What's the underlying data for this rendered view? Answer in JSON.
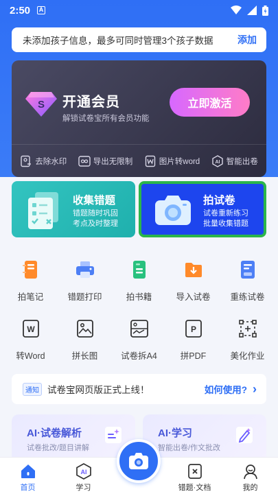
{
  "status": {
    "time": "2:50",
    "badge": "A"
  },
  "notice": {
    "text": "未添加孩子信息，最多可同时管理3个孩子数据",
    "action": "添加"
  },
  "vip": {
    "title": "开通会员",
    "subtitle": "解锁试卷宝所有会员功能",
    "button": "立即激活",
    "features": [
      {
        "label": "去除水印",
        "icon": "no-watermark-icon"
      },
      {
        "label": "导出无限制",
        "icon": "infinity-icon"
      },
      {
        "label": "图片转word",
        "icon": "word-doc-icon"
      },
      {
        "label": "智能出卷",
        "icon": "ai-icon"
      }
    ],
    "gem_letter": "S"
  },
  "cards": {
    "collect": {
      "title": "收集错题",
      "sub1": "错题随时巩固",
      "sub2": "考点及时整理"
    },
    "shoot": {
      "title": "拍试卷",
      "sub1": "试卷重新练习",
      "sub2": "批量收集错题"
    }
  },
  "tools_row1": [
    {
      "label": "拍笔记",
      "icon": "notebook-icon",
      "color": "#ff8a2a"
    },
    {
      "label": "错题打印",
      "icon": "printer-icon",
      "color": "#4d7ff5"
    },
    {
      "label": "拍书籍",
      "icon": "book-icon",
      "color": "#28c17e"
    },
    {
      "label": "导入试卷",
      "icon": "folder-import-icon",
      "color": "#ff8a2a"
    },
    {
      "label": "重练试卷",
      "icon": "paper-redo-icon",
      "color": "#4d7ff5"
    }
  ],
  "tools_row2": [
    {
      "label": "转Word",
      "icon": "word-icon",
      "glyph": "W"
    },
    {
      "label": "拼长图",
      "icon": "long-image-icon"
    },
    {
      "label": "试卷拆A4",
      "icon": "split-a4-icon"
    },
    {
      "label": "拼PDF",
      "icon": "pdf-icon",
      "glyph": "P"
    },
    {
      "label": "美化作业",
      "icon": "beautify-icon"
    }
  ],
  "announce": {
    "tag": "通知",
    "text": "试卷宝网页版正式上线！",
    "link": "如何使用?",
    "arrow": "›"
  },
  "ai_cards": [
    {
      "title": "AI·试卷解析",
      "sub": "试卷批改/题目讲解"
    },
    {
      "title": "AI·学习",
      "sub": "智能出卷/作文批改"
    }
  ],
  "tabs": [
    {
      "label": "首页",
      "icon": "home-icon"
    },
    {
      "label": "学习",
      "icon": "ai-study-icon",
      "glyph": "AI"
    },
    {
      "label": "",
      "icon": "camera-icon"
    },
    {
      "label": "错题·文档",
      "icon": "wrong-doc-icon"
    },
    {
      "label": "我的",
      "icon": "profile-icon"
    }
  ],
  "colors": {
    "primary": "#2f6ff5",
    "teal": "#1fb0ad",
    "shoot_bg": "#1d45ee",
    "highlight": "#2bb54a"
  }
}
